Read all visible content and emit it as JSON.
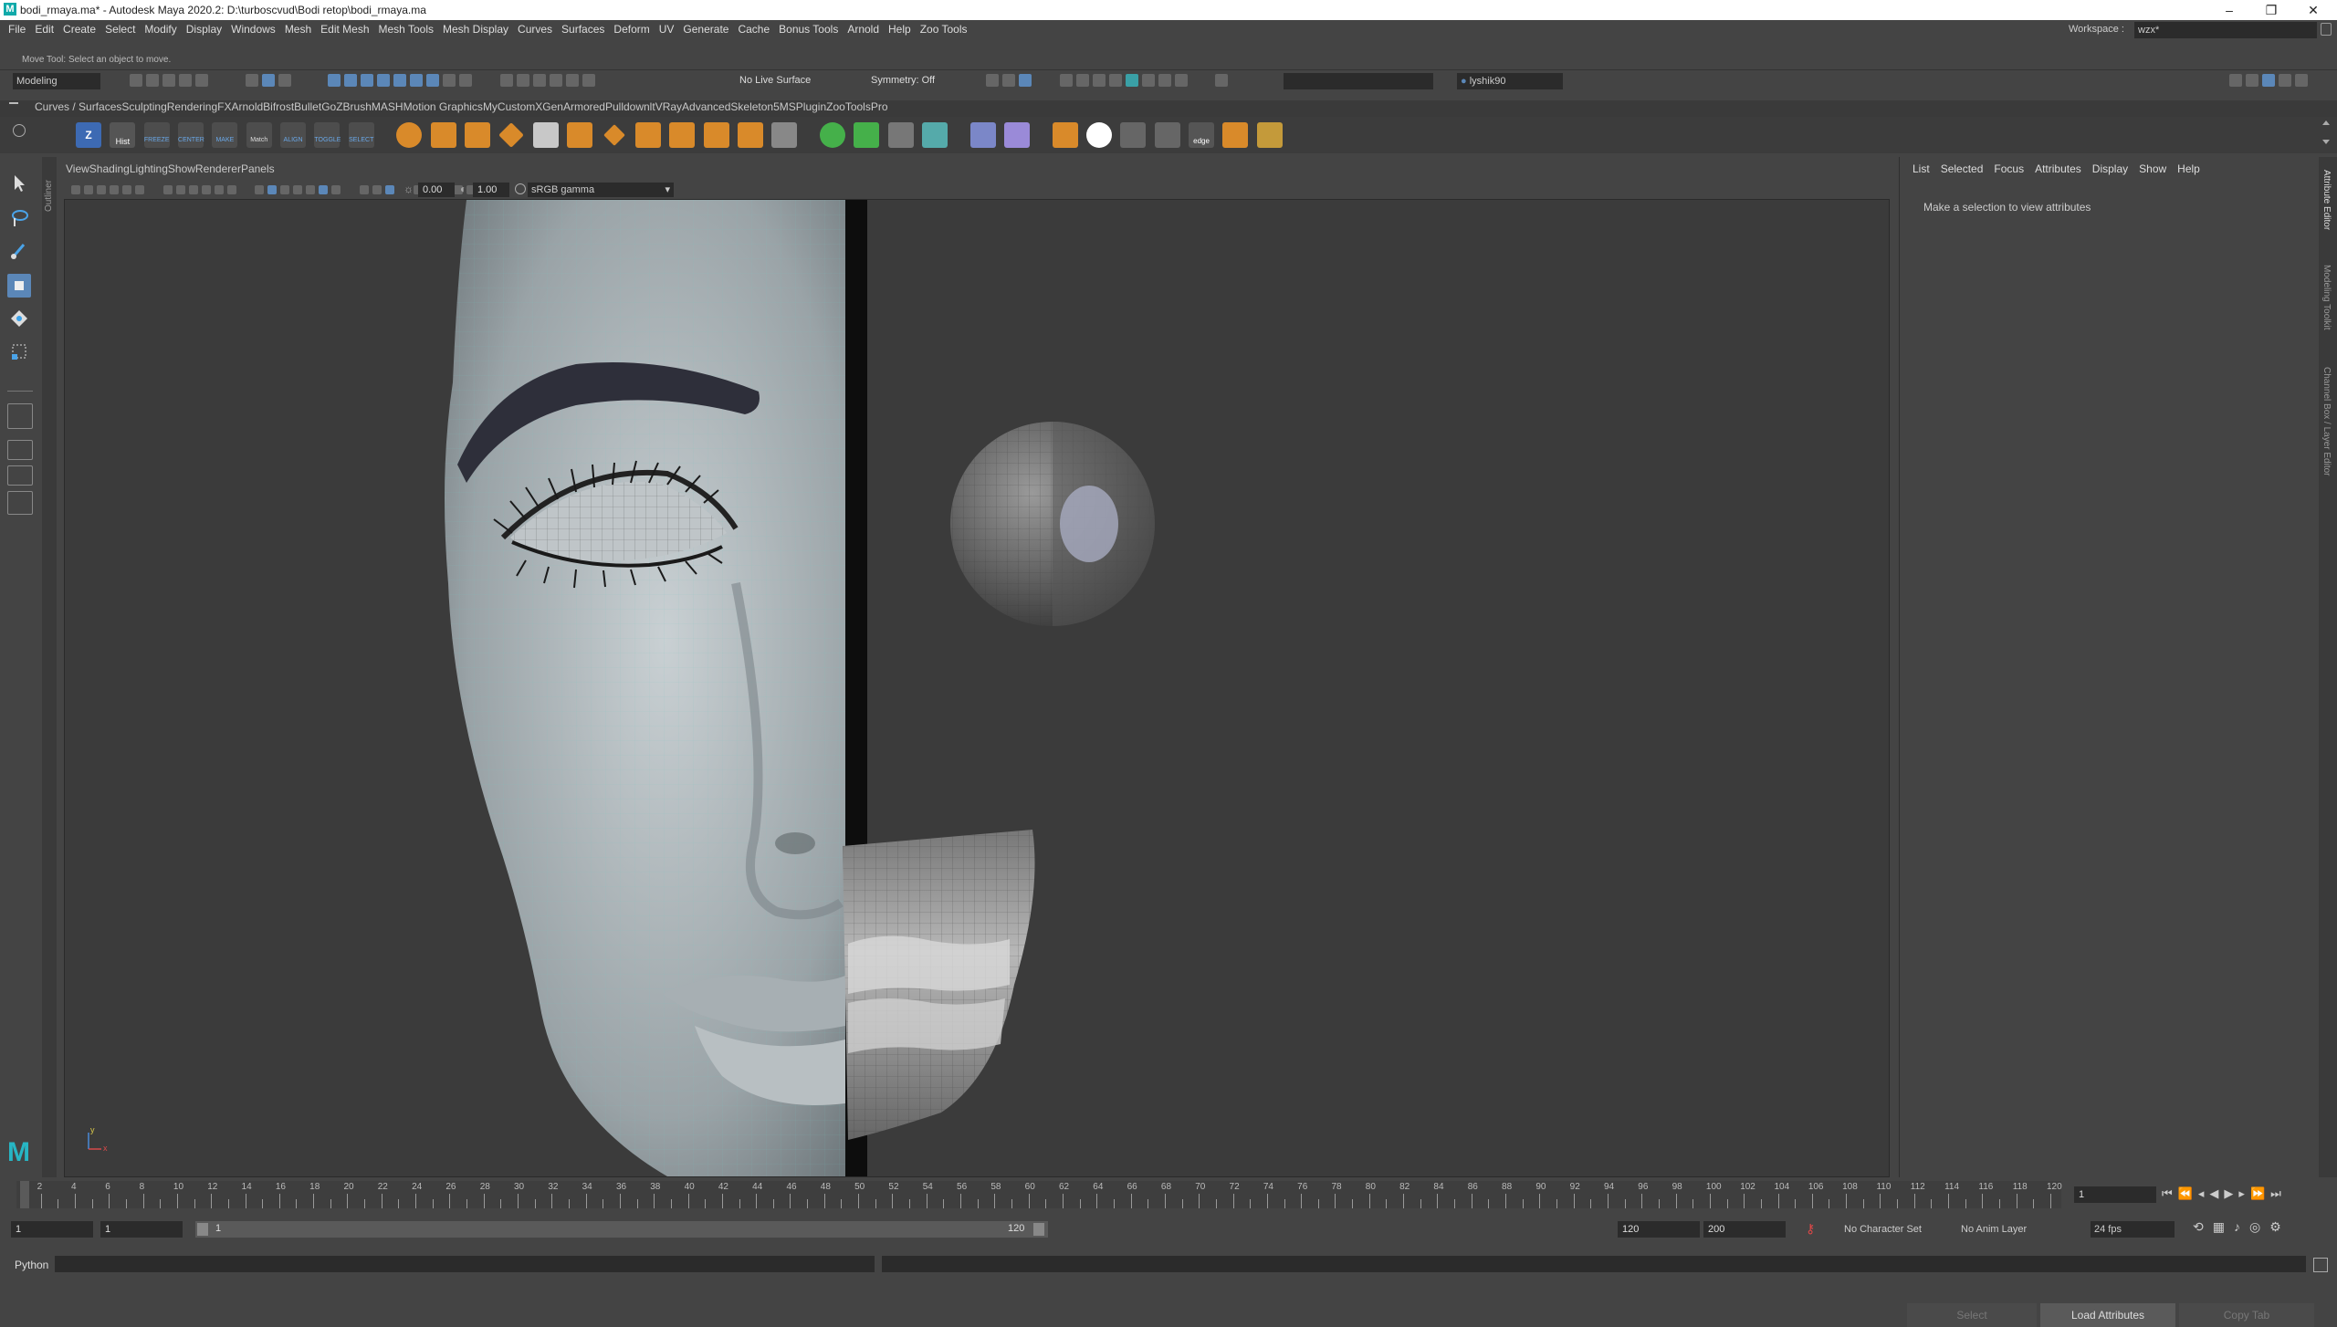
{
  "window": {
    "title": "bodi_rmaya.ma* - Autodesk Maya 2020.2: D:\\turboscvud\\Bodi retop\\bodi_rmaya.ma",
    "controls": [
      "–",
      "❐",
      "✕"
    ]
  },
  "menubar": {
    "items": [
      "File",
      "Edit",
      "Create",
      "Select",
      "Modify",
      "Display",
      "Windows",
      "Mesh",
      "Edit Mesh",
      "Mesh Tools",
      "Mesh Display",
      "Curves",
      "Surfaces",
      "Deform",
      "UV",
      "Generate",
      "Cache",
      "Bonus Tools",
      "Arnold",
      "Help",
      "Zoo Tools"
    ],
    "workspace_label": "Workspace :",
    "workspace_value": "wzx*"
  },
  "statusline": {
    "mode": "Modeling",
    "live_surface": "No Live Surface",
    "symmetry": "Symmetry: Off",
    "user": "lyshik90"
  },
  "help_line": "Move Tool: Select an object to move.",
  "shelf": {
    "tabs": [
      "Curves / Surfaces",
      "Sculpting",
      "Rendering",
      "FX",
      "Arnold",
      "Bifrost",
      "Bullet",
      "GoZBrush",
      "MASH",
      "Motion Graphics",
      "MyCustom",
      "XGen",
      "Armored",
      "Pulldownlt",
      "VRay",
      "AdvancedSkeleton5",
      "MSPlugin",
      "ZooToolsPro"
    ],
    "active_tab": "MyCustom",
    "labels": [
      "Hist",
      "FREEZE",
      "CENTER",
      "MAKE",
      "Match",
      "ALIGN",
      "TOGGLE",
      "SELECT",
      "edge"
    ]
  },
  "viewport": {
    "menu": [
      "View",
      "Shading",
      "Lighting",
      "Show",
      "Renderer",
      "Panels"
    ],
    "exposure": "0.00",
    "gamma": "1.00",
    "color_space": "sRGB gamma"
  },
  "attribute_editor": {
    "menu": [
      "List",
      "Selected",
      "Focus",
      "Attributes",
      "Display",
      "Show",
      "Help"
    ],
    "message": "Make a selection to view attributes",
    "buttons": [
      "Select",
      "Load Attributes",
      "Copy Tab"
    ],
    "side_tabs": [
      "Attribute Editor",
      "Modeling Toolkit",
      "Channel Box / Layer Editor"
    ],
    "outliner_tab": "Outliner"
  },
  "timeline": {
    "ticks": [
      "1",
      "2",
      "4",
      "6",
      "8",
      "10",
      "12",
      "14",
      "16",
      "18",
      "20",
      "22",
      "24",
      "26",
      "28",
      "30",
      "32",
      "34",
      "36",
      "38",
      "40",
      "42",
      "44",
      "46",
      "48",
      "50",
      "52",
      "54",
      "56",
      "58",
      "60",
      "62",
      "64",
      "66",
      "68",
      "70",
      "72",
      "74",
      "76",
      "78",
      "80",
      "82",
      "84",
      "86",
      "88",
      "90",
      "92",
      "94",
      "96",
      "98",
      "100",
      "102",
      "104",
      "106",
      "108",
      "110",
      "112",
      "114",
      "116",
      "118",
      "120"
    ],
    "current_frame": "1"
  },
  "range": {
    "start": "1",
    "playback_start": "1",
    "slider_start": "1",
    "slider_end": "120",
    "playback_end": "120",
    "end": "200",
    "character_set": "No Character Set",
    "anim_layer": "No Anim Layer",
    "fps": "24 fps"
  },
  "command_line": {
    "language": "Python"
  }
}
